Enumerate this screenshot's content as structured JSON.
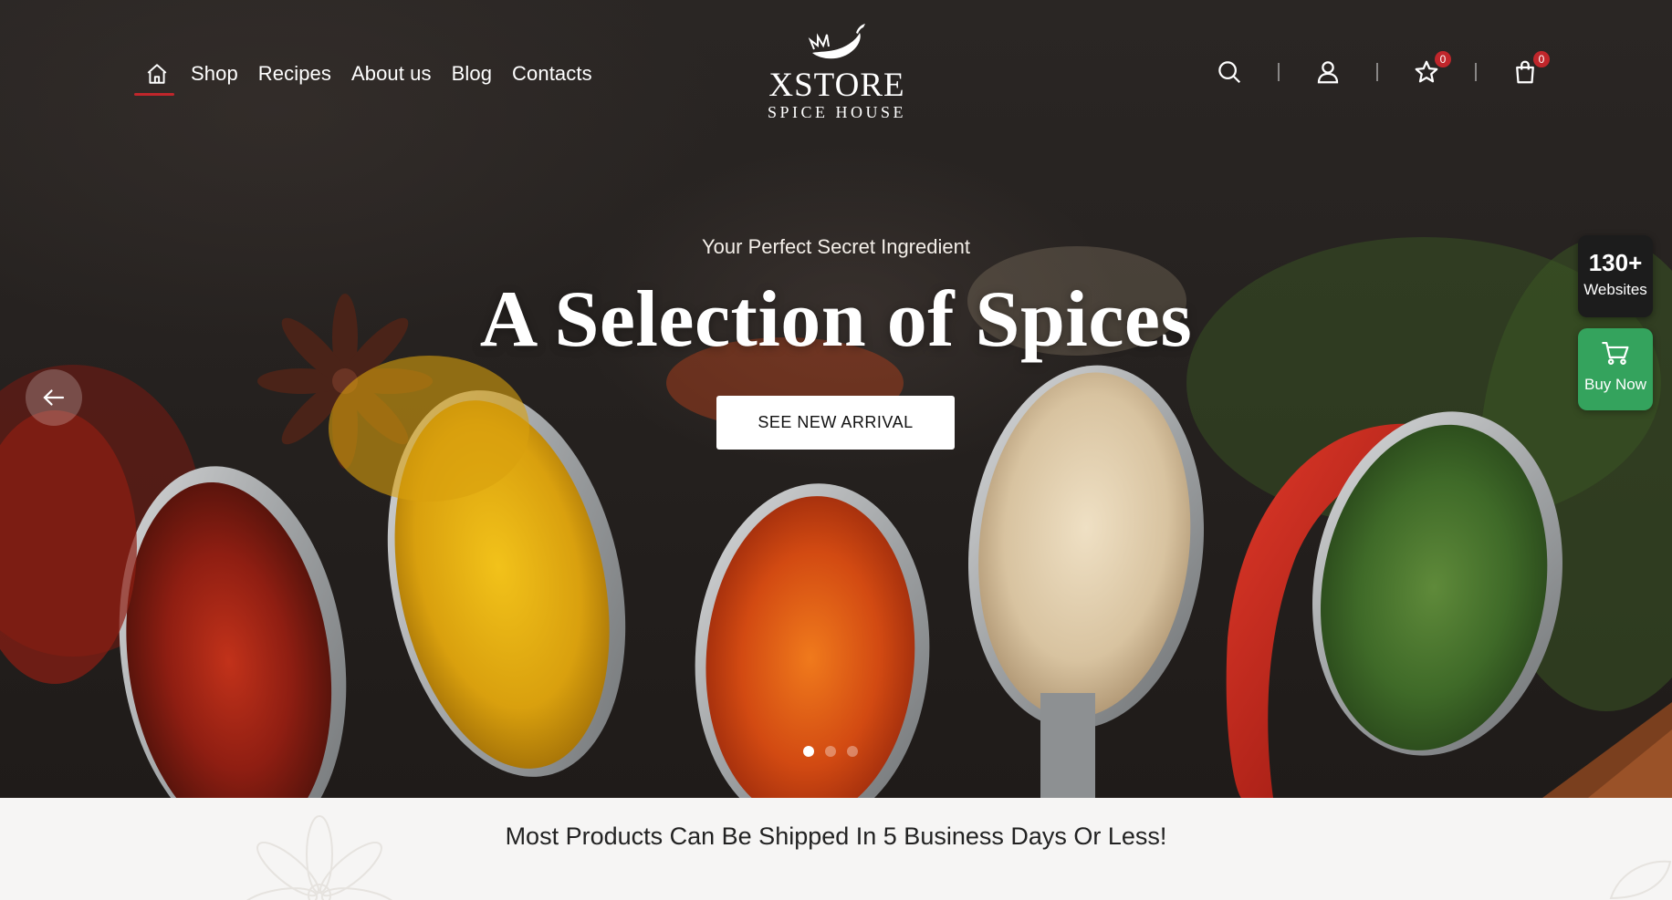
{
  "header": {
    "nav": [
      {
        "label": "Shop"
      },
      {
        "label": "Recipes"
      },
      {
        "label": "About us"
      },
      {
        "label": "Blog"
      },
      {
        "label": "Contacts"
      }
    ],
    "logo": {
      "name": "XSTORE",
      "subtitle": "SPICE HOUSE"
    },
    "wishlist_count": "0",
    "cart_count": "0",
    "icons": [
      "home-icon",
      "search-icon",
      "user-icon",
      "star-icon",
      "shopping-bag-icon"
    ]
  },
  "hero": {
    "tagline": "Your Perfect Secret Ingredient",
    "headline": "A Selection of Spices",
    "cta_label": "SEE NEW ARRIVAL",
    "slide_count": 3,
    "active_slide": 1
  },
  "widgets": {
    "websites_count": "130+",
    "websites_label": "Websites",
    "buy_label": "Buy Now"
  },
  "shipping_notice": "Most Products Can Be Shipped In 5 Business Days Or Less!",
  "colors": {
    "accent": "#c0262b",
    "buy_green": "#34a35d",
    "hero_bg": "#262220",
    "shipbar_bg": "#f6f5f4"
  }
}
